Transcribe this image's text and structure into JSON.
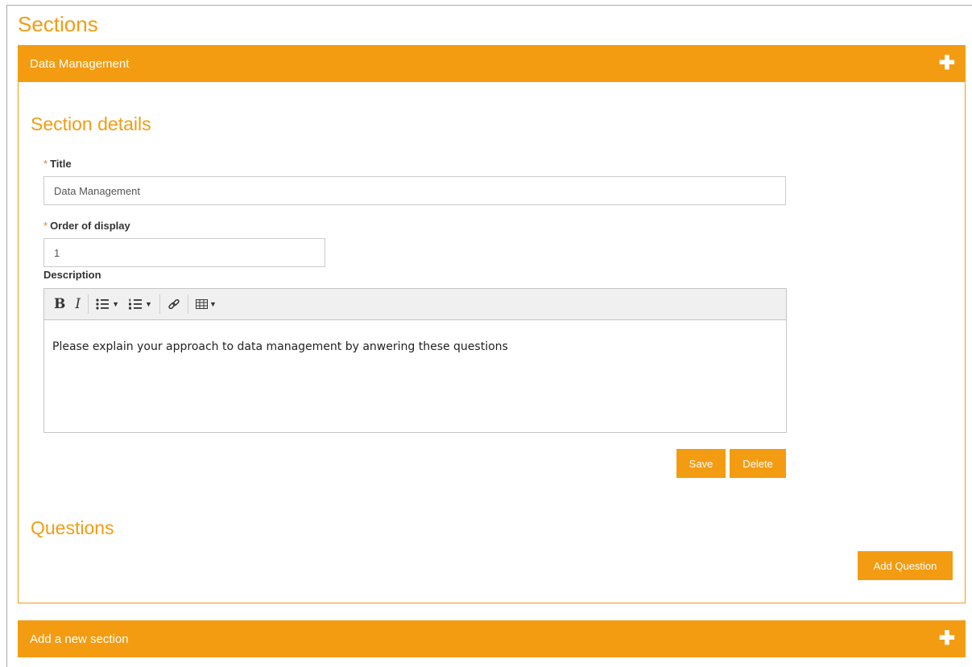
{
  "page": {
    "title": "Sections"
  },
  "sections": [
    {
      "header": "Data Management",
      "toggle_icon": "plus-icon"
    }
  ],
  "section_details": {
    "heading": "Section details",
    "title_field": {
      "required_mark": "*",
      "label": "Title",
      "value": "Data Management"
    },
    "order_field": {
      "required_mark": "*",
      "label": "Order of display",
      "value": "1"
    },
    "description_field": {
      "label": "Description",
      "content": "Please explain your approach to data management by anwering these questions",
      "toolbar": [
        "bold-icon",
        "italic-icon",
        "bullet-list-icon",
        "numbered-list-icon",
        "link-icon",
        "table-icon"
      ]
    },
    "save_label": "Save",
    "delete_label": "Delete"
  },
  "questions": {
    "heading": "Questions",
    "add_label": "Add Question"
  },
  "new_section": {
    "header": "Add a new section",
    "toggle_icon": "plus-icon"
  },
  "colors": {
    "accent": "#f39c12",
    "required": "#e67e22",
    "border": "#cccccc"
  }
}
